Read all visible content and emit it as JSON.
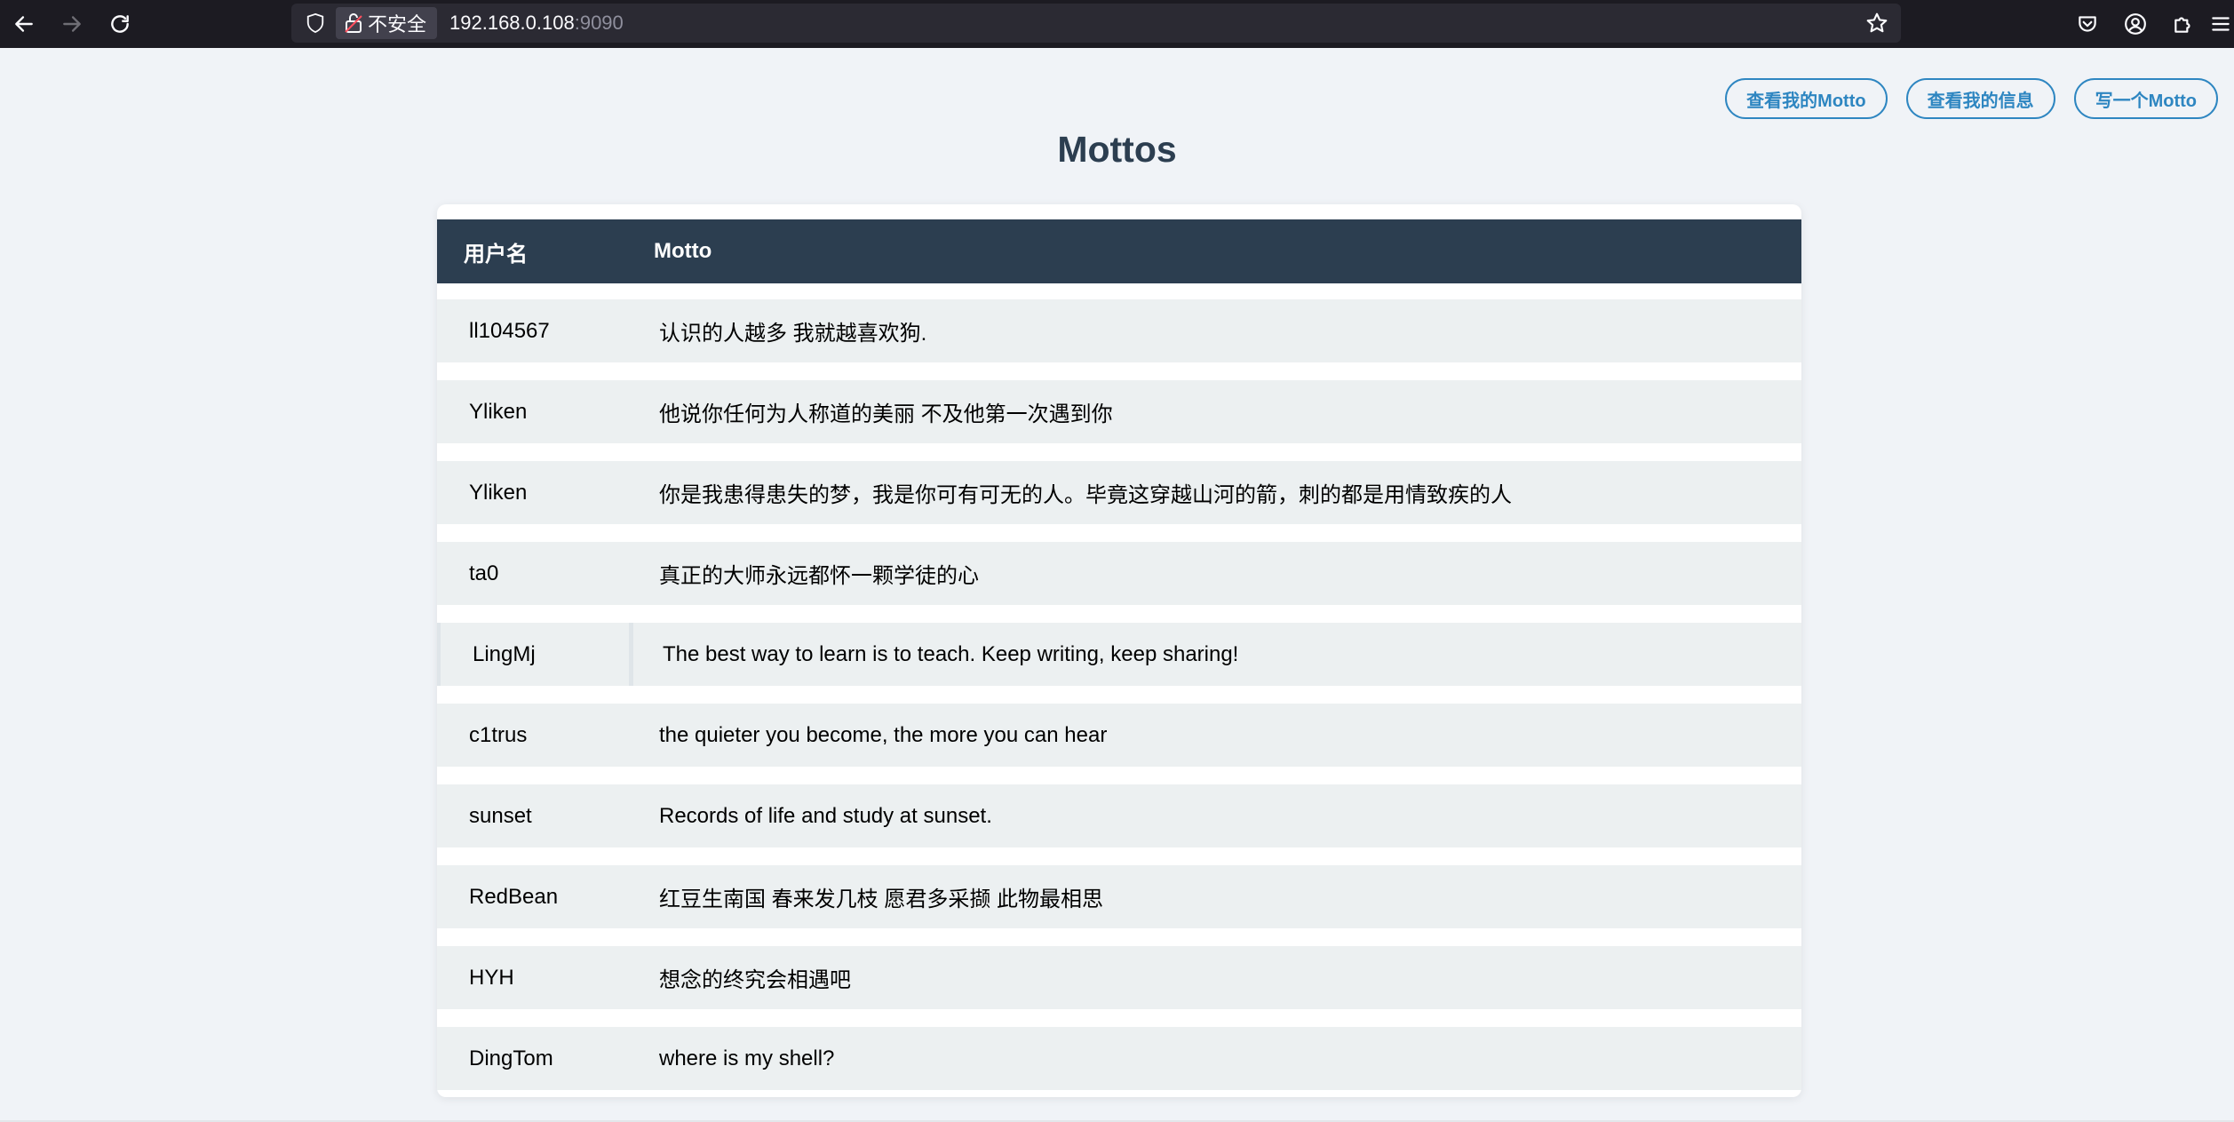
{
  "browser": {
    "address": {
      "host": "192.168.0.108",
      "port": ":9090"
    },
    "insecure_label": "不安全"
  },
  "header": {
    "buttons": [
      "查看我的Motto",
      "查看我的信息",
      "写一个Motto"
    ]
  },
  "title": "Mottos",
  "table": {
    "columns": [
      "用户名",
      "Motto"
    ],
    "rows": [
      {
        "user": "ll104567",
        "motto": "认识的人越多 我就越喜欢狗."
      },
      {
        "user": "Yliken",
        "motto": "他说你任何为人称道的美丽 不及他第一次遇到你"
      },
      {
        "user": "Yliken",
        "motto": "你是我患得患失的梦，我是你可有可无的人。毕竟这穿越山河的箭，刺的都是用情致疾的人"
      },
      {
        "user": "ta0",
        "motto": "真正的大师永远都怀一颗学徒的心"
      },
      {
        "user": "LingMj",
        "motto": "The best way to learn is to teach. Keep writing, keep sharing!"
      },
      {
        "user": "c1trus",
        "motto": "the quieter you become, the more you can hear"
      },
      {
        "user": "sunset",
        "motto": "Records of life and study at sunset."
      },
      {
        "user": "RedBean",
        "motto": "红豆生南国 春来发几枝 愿君多采撷 此物最相思"
      },
      {
        "user": "HYH",
        "motto": "想念的终究会相遇吧"
      },
      {
        "user": "DingTom",
        "motto": "where is my shell?"
      }
    ]
  }
}
